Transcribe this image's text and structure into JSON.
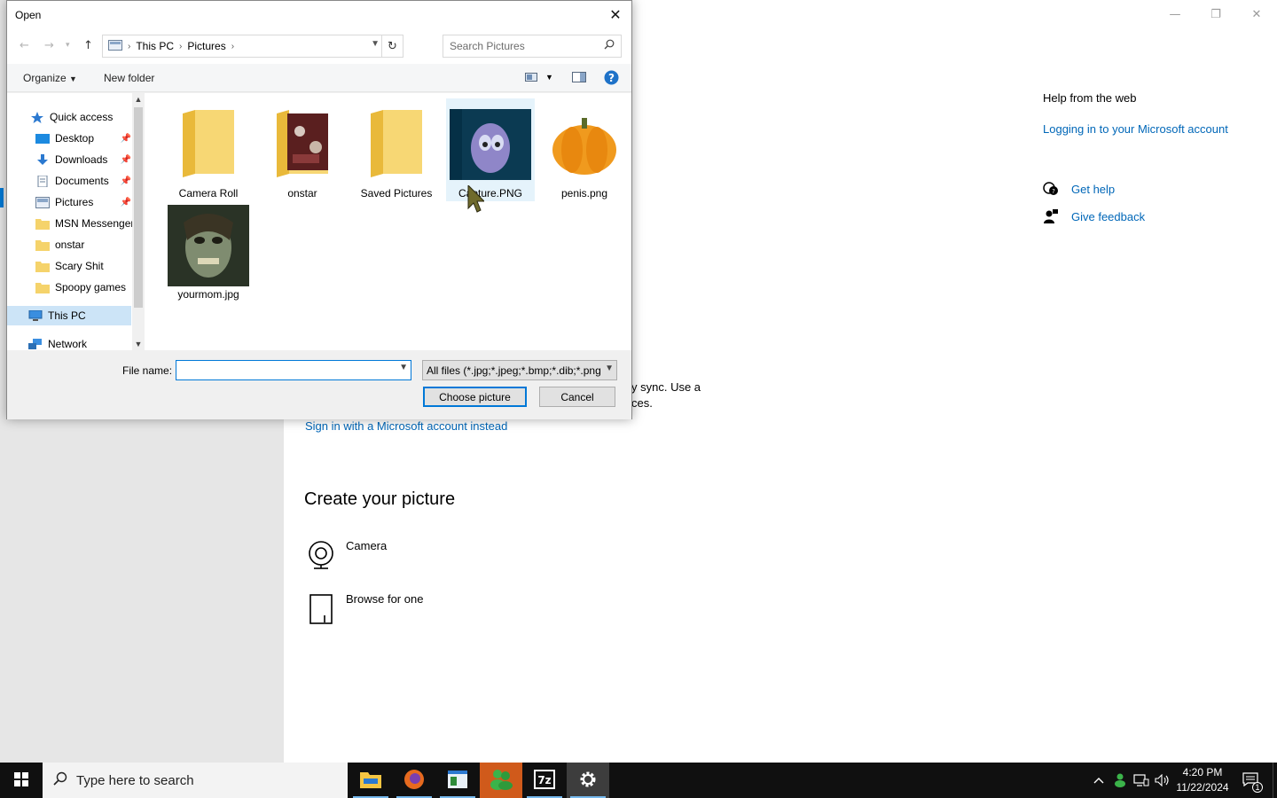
{
  "settings": {
    "window_controls": [
      "—",
      "❐",
      "✕"
    ],
    "help_title": "Help from the web",
    "help_link": "Logging in to your Microsoft account",
    "get_help": "Get help",
    "give_feedback": "Give feedback",
    "sync_line1": "y sync. Use a",
    "sync_line2": "ces.",
    "signin_link": "Sign in with a Microsoft account instead",
    "create_title": "Create your picture",
    "camera_label": "Camera",
    "browse_label": "Browse for one"
  },
  "dialog": {
    "title": "Open",
    "breadcrumb": [
      "This PC",
      "Pictures"
    ],
    "search_placeholder": "Search Pictures",
    "organize": "Organize",
    "new_folder": "New folder",
    "nav_items": [
      {
        "label": "Quick access",
        "icon": "star-icon"
      },
      {
        "label": "Desktop",
        "icon": "desktop-icon",
        "pinned": true
      },
      {
        "label": "Downloads",
        "icon": "download-icon",
        "pinned": true
      },
      {
        "label": "Documents",
        "icon": "documents-icon",
        "pinned": true
      },
      {
        "label": "Pictures",
        "icon": "pictures-icon",
        "pinned": true
      },
      {
        "label": "MSN Messenger",
        "icon": "folder-icon"
      },
      {
        "label": "onstar",
        "icon": "folder-icon"
      },
      {
        "label": "Scary Shit",
        "icon": "folder-icon"
      },
      {
        "label": "Spoopy games",
        "icon": "folder-icon"
      },
      {
        "label": "This PC",
        "icon": "computer-icon"
      },
      {
        "label": "Network",
        "icon": "network-icon"
      }
    ],
    "files": [
      {
        "name": "Camera Roll",
        "type": "folder"
      },
      {
        "name": "onstar",
        "type": "folder"
      },
      {
        "name": "Saved Pictures",
        "type": "folder"
      },
      {
        "name": "Capture.PNG",
        "type": "image"
      },
      {
        "name": "penis.png",
        "type": "image"
      },
      {
        "name": "yourmom.jpg",
        "type": "image"
      }
    ],
    "file_name_label": "File name:",
    "file_name_value": "",
    "filter": "All files (*.jpg;*.jpeg;*.bmp;*.dib;*.png",
    "choose_button": "Choose picture",
    "cancel_button": "Cancel"
  },
  "taskbar": {
    "search_placeholder": "Type here to search",
    "time": "4:20 PM",
    "date": "11/22/2024",
    "notification_count": "1",
    "accent_color": "#76b9ed"
  }
}
